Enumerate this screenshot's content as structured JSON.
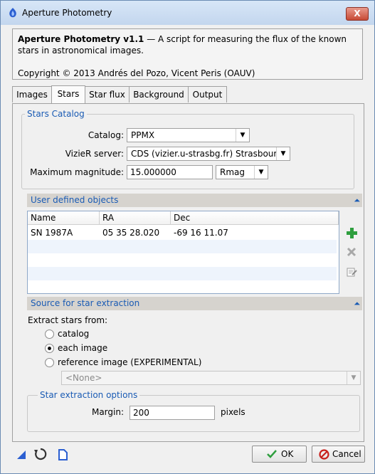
{
  "window": {
    "title": "Aperture Photometry",
    "close_symbol": "X"
  },
  "info": {
    "heading": "Aperture Photometry v1.1",
    "description": " — A script for measuring the flux of the known stars in astronomical images.",
    "copyright": "Copyright © 2013 Andrés del Pozo, Vicent Peris (OAUV)"
  },
  "tabs": [
    "Images",
    "Stars",
    "Star flux",
    "Background",
    "Output"
  ],
  "active_tab": "Stars",
  "stars_catalog": {
    "title": "Stars Catalog",
    "catalog_label": "Catalog:",
    "catalog_value": "PPMX",
    "vizier_label": "VizieR server:",
    "vizier_value": "CDS (vizier.u-strasbg.fr) Strasbourg, I",
    "maxmag_label": "Maximum magnitude:",
    "maxmag_value": "15.000000",
    "mag_band": "Rmag"
  },
  "user_objects": {
    "title": "User defined objects",
    "columns": [
      "Name",
      "RA",
      "Dec"
    ],
    "rows": [
      {
        "name": "SN 1987A",
        "ra": "05 35 28.020",
        "dec": "-69 16 11.07"
      }
    ]
  },
  "source": {
    "title": "Source for star extraction",
    "extract_label": "Extract stars from:",
    "options": [
      "catalog",
      "each image",
      "reference image (EXPERIMENTAL)"
    ],
    "selected": "each image",
    "reference_value": "<None>"
  },
  "extraction_options": {
    "title": "Star extraction options",
    "margin_label": "Margin:",
    "margin_value": "200",
    "margin_unit": "pixels"
  },
  "buttons": {
    "ok": "OK",
    "cancel": "Cancel"
  },
  "colors": {
    "accent": "#1a5bb4",
    "add": "#2e9e3e",
    "cancel": "#c8201b"
  }
}
